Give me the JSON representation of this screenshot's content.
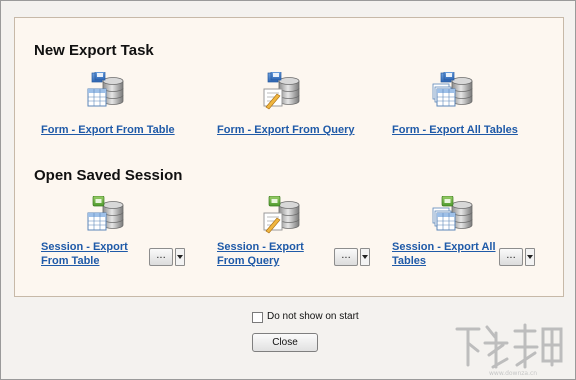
{
  "new_export_task": {
    "title": "New Export Task",
    "items": [
      {
        "label": "Form - Export From Table",
        "icon": "export-table-icon"
      },
      {
        "label": "Form - Export From Query",
        "icon": "export-query-icon"
      },
      {
        "label": "Form - Export All Tables",
        "icon": "export-all-tables-icon"
      }
    ]
  },
  "open_saved_session": {
    "title": "Open Saved Session",
    "items": [
      {
        "label": "Session - Export From Table",
        "icon": "session-table-icon",
        "more_label": "..."
      },
      {
        "label": "Session - Export From Query",
        "icon": "session-query-icon",
        "more_label": "..."
      },
      {
        "label": "Session - Export All Tables",
        "icon": "session-all-tables-icon",
        "more_label": "..."
      }
    ]
  },
  "footer": {
    "checkbox_label": "Do not show on start",
    "checkbox_checked": false,
    "close_label": "Close"
  },
  "colors": {
    "link": "#1f5aa8",
    "panel_bg": "#fdf7f0",
    "window_bg": "#f4f2ef",
    "panel_border": "#c7b9a8",
    "watermark": "#bdbdbd"
  }
}
